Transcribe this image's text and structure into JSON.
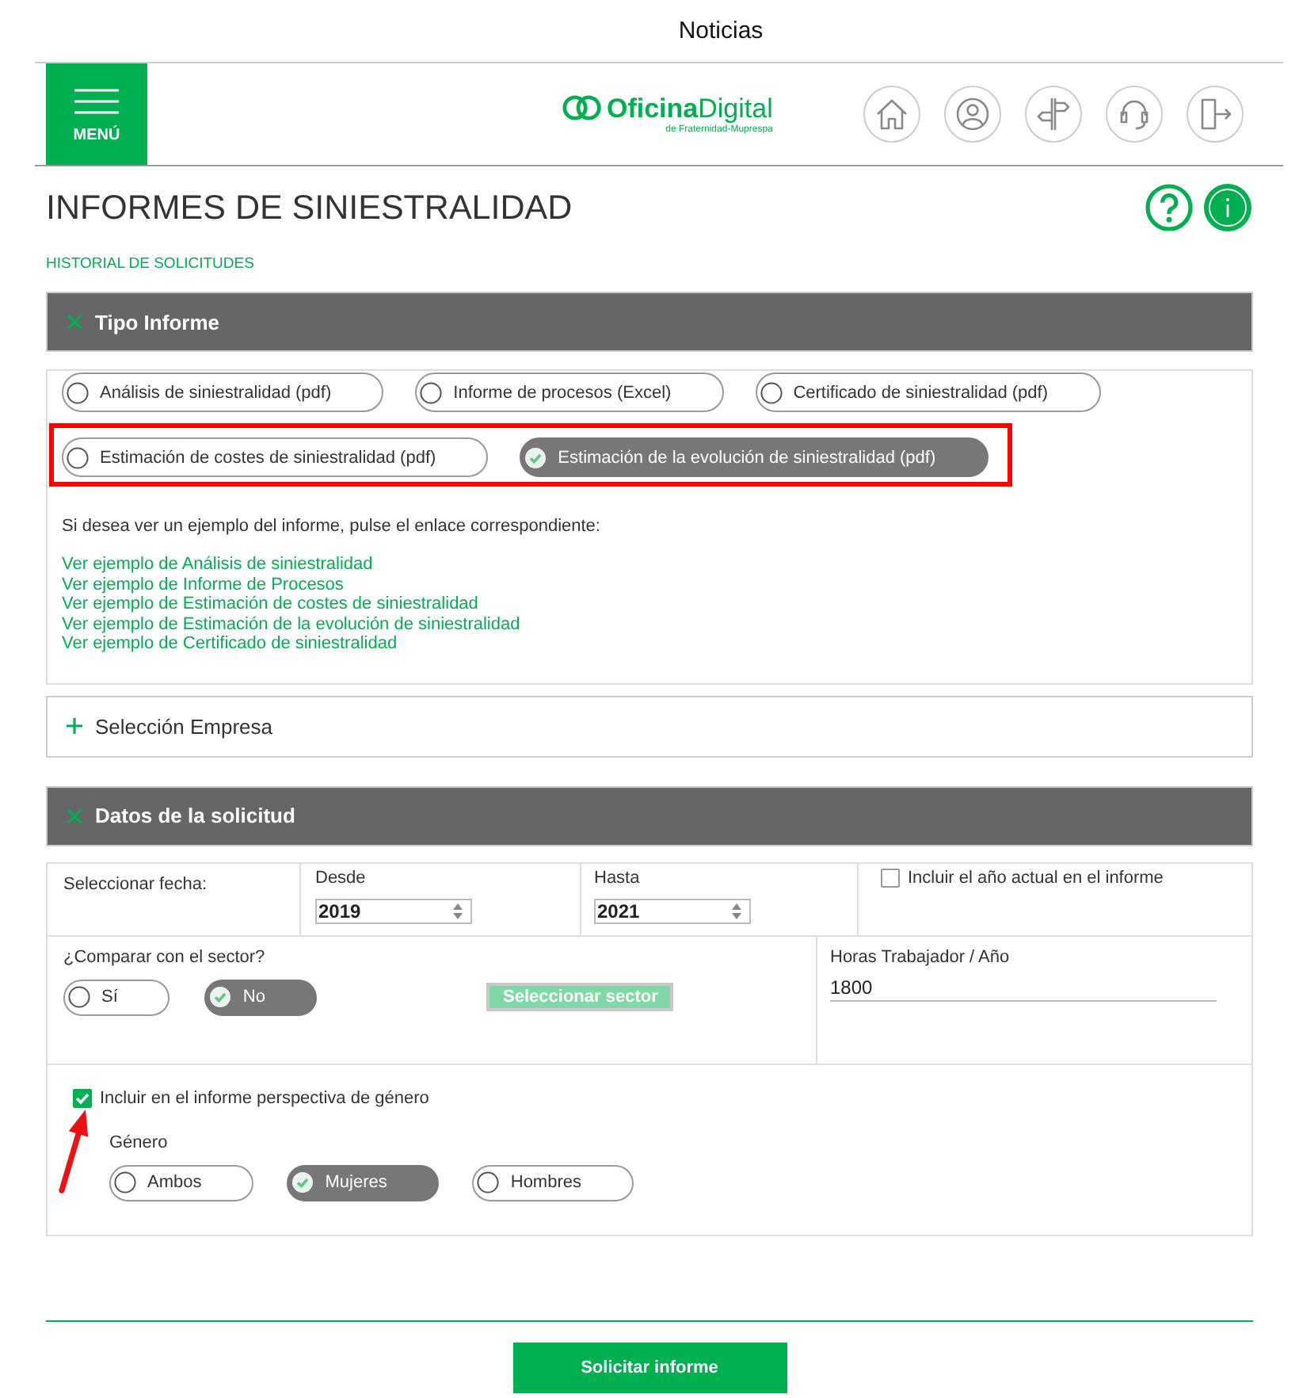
{
  "top_bar": {
    "title": "Noticias"
  },
  "header": {
    "menu_label": "MENÚ",
    "logo_text": "**Oficina**Digital",
    "logo_tagline": "de Fraternidad-Muprespa"
  },
  "page": {
    "title": "INFORMES DE SINIESTRALIDAD",
    "history_link": "HISTORIAL DE SOLICITUDES"
  },
  "report_type": {
    "title": "Tipo Informe",
    "expanded": true,
    "option_rows": [
      {
        "highlighted": false,
        "options": [
          {
            "label": "Análisis de siniestralidad (pdf)",
            "selected": false
          },
          {
            "label": "Informe de procesos (Excel)",
            "selected": false
          },
          {
            "label": "Certificado de siniestralidad (pdf)",
            "selected": false
          }
        ]
      },
      {
        "highlighted": true,
        "options": [
          {
            "label": "Estimación de costes de siniestralidad (pdf)",
            "selected": false
          },
          {
            "label": "Estimación de la evolución de siniestralidad (pdf)",
            "selected": true
          }
        ]
      }
    ],
    "examples_intro": "Si desea ver un ejemplo del informe, pulse el enlace correspondiente:",
    "example_links": [
      "Ver ejemplo de Análisis de siniestralidad",
      "Ver ejemplo de Informe de Procesos",
      "Ver ejemplo de Estimación de costes de siniestralidad",
      "Ver ejemplo de Estimación de la evolución de siniestralidad",
      "Ver ejemplo de Certificado de siniestralidad"
    ]
  },
  "company_selection": {
    "title": "Selección Empresa",
    "expanded": false
  },
  "request_data": {
    "title": "Datos de la solicitud",
    "expanded": true,
    "date_label": "Seleccionar fecha:",
    "from": {
      "label": "Desde",
      "value": "2019"
    },
    "to": {
      "label": "Hasta",
      "value": "2021"
    },
    "include_current_year": {
      "label": "Incluir el año actual en el informe",
      "checked": false
    },
    "compare": {
      "label": "¿Comparar con el sector?",
      "options": [
        {
          "label": "Sí",
          "selected": false
        },
        {
          "label": "No",
          "selected": true
        }
      ]
    },
    "sector_button": {
      "label": "Seleccionar sector",
      "disabled": true
    },
    "hours": {
      "label": "Horas Trabajador / Año",
      "value": "1800"
    },
    "gender_perspective": {
      "label": "Incluir en el informe perspectiva de género",
      "checked": true,
      "annotated": true
    },
    "gender": {
      "label": "Género",
      "options": [
        {
          "label": "Ambos",
          "selected": false
        },
        {
          "label": "Mujeres",
          "selected": true
        },
        {
          "label": "Hombres",
          "selected": false
        }
      ]
    }
  },
  "submit_button": "Solicitar informe"
}
